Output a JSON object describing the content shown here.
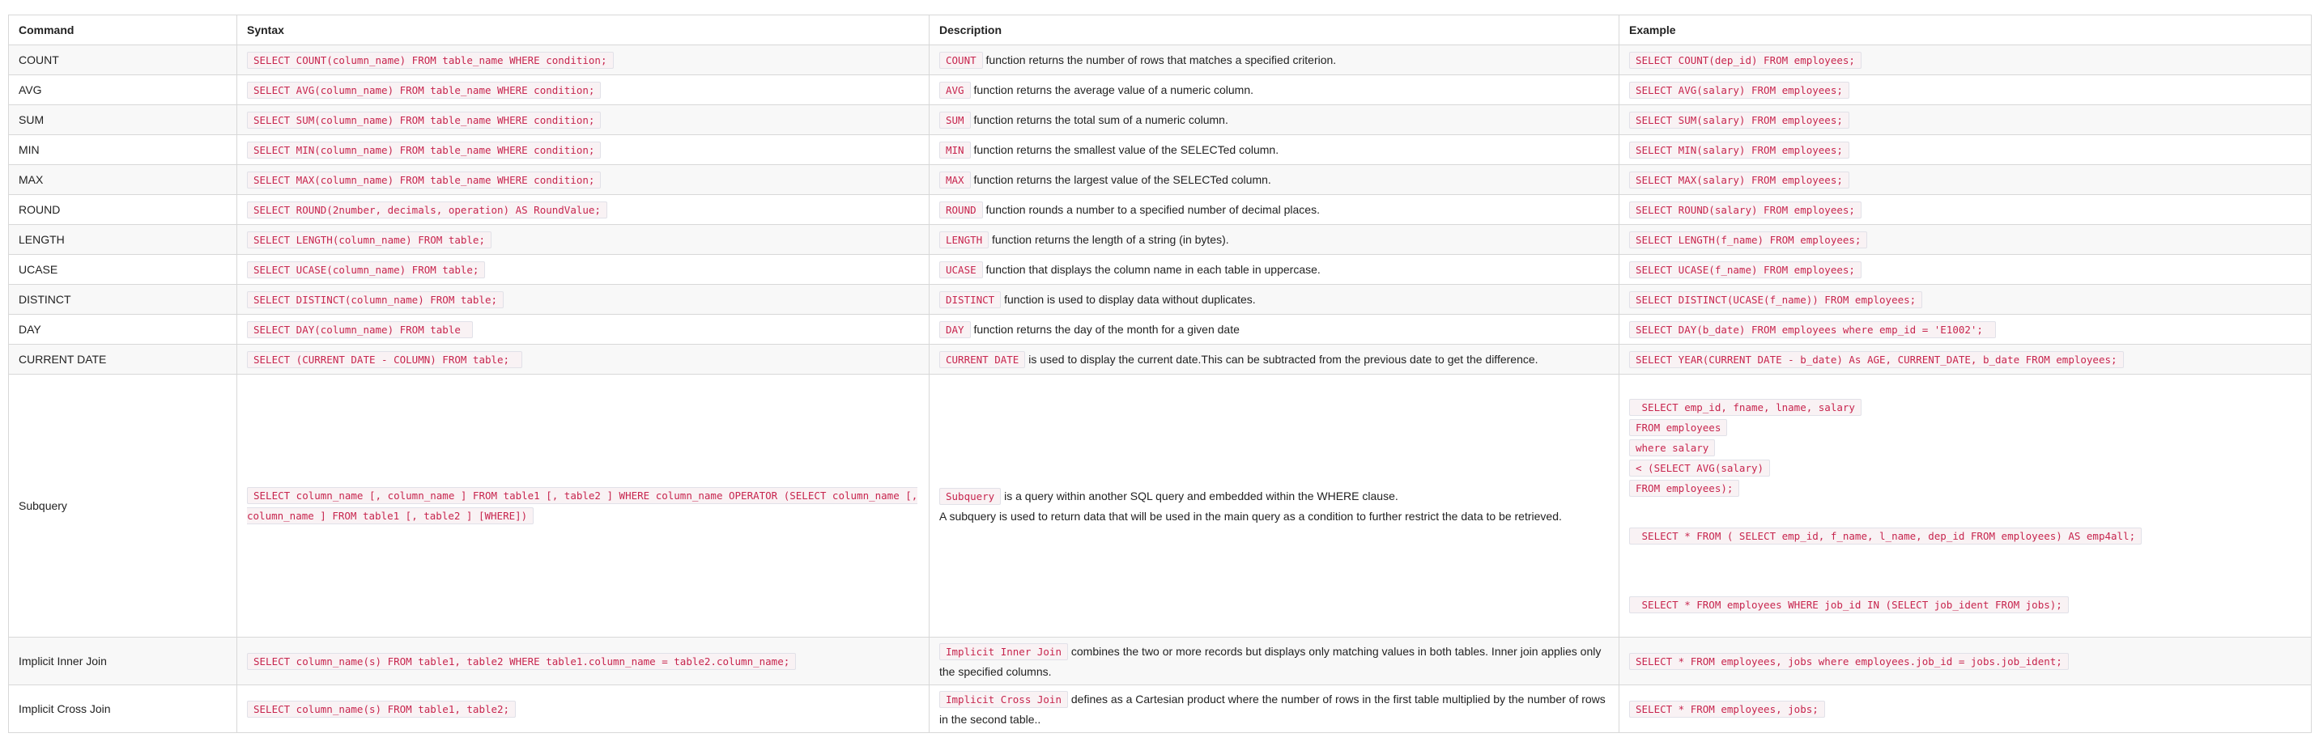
{
  "headers": {
    "command": "Command",
    "syntax": "Syntax",
    "description": "Description",
    "example": "Example"
  },
  "rows": [
    {
      "command": "COUNT",
      "syntax": "SELECT COUNT(column_name) FROM table_name WHERE condition;",
      "desc_code": "COUNT",
      "desc_text": "function returns the number of rows that matches a specified criterion.",
      "example": "SELECT COUNT(dep_id) FROM employees;"
    },
    {
      "command": "AVG",
      "syntax": "SELECT AVG(column_name) FROM table_name WHERE condition;",
      "desc_code": "AVG",
      "desc_text": "function returns the average value of a numeric column.",
      "example": "SELECT AVG(salary) FROM employees;"
    },
    {
      "command": "SUM",
      "syntax": "SELECT SUM(column_name) FROM table_name WHERE condition;",
      "desc_code": "SUM",
      "desc_text": "function returns the total sum of a numeric column.",
      "example": "SELECT SUM(salary) FROM employees;"
    },
    {
      "command": "MIN",
      "syntax": "SELECT MIN(column_name) FROM table_name WHERE condition;",
      "desc_code": "MIN",
      "desc_text": "function returns the smallest value of the SELECTed column.",
      "example": "SELECT MIN(salary) FROM employees;"
    },
    {
      "command": "MAX",
      "syntax": "SELECT MAX(column_name) FROM table_name WHERE condition;",
      "desc_code": "MAX",
      "desc_text": "function returns the largest value of the SELECTed column.",
      "example": "SELECT MAX(salary) FROM employees;"
    },
    {
      "command": "ROUND",
      "syntax": "SELECT ROUND(2number, decimals, operation) AS RoundValue;",
      "desc_code": "ROUND",
      "desc_text": "function rounds a number to a specified number of decimal places.",
      "example": "SELECT ROUND(salary) FROM employees;"
    },
    {
      "command": "LENGTH",
      "syntax": "SELECT LENGTH(column_name) FROM table;",
      "desc_code": "LENGTH",
      "desc_text": "function returns the length of a string (in bytes).",
      "example": "SELECT LENGTH(f_name) FROM employees;"
    },
    {
      "command": "UCASE",
      "syntax": "SELECT UCASE(column_name) FROM table;",
      "desc_code": "UCASE",
      "desc_text": "function that displays the column name in each table in uppercase.",
      "example": "SELECT UCASE(f_name) FROM employees;"
    },
    {
      "command": "DISTINCT",
      "syntax": "SELECT DISTINCT(column_name) FROM table;",
      "desc_code": "DISTINCT",
      "desc_text": "function is used to display data without duplicates.",
      "example": "SELECT DISTINCT(UCASE(f_name)) FROM employees;"
    },
    {
      "command": "DAY",
      "syntax": "SELECT DAY(column_name) FROM table ",
      "desc_code": "DAY",
      "desc_text": "function returns the day of the month for a given date",
      "example": "SELECT DAY(b_date) FROM employees where emp_id = 'E1002'; "
    },
    {
      "command": "CURRENT DATE",
      "syntax": "SELECT (CURRENT DATE - COLUMN) FROM table; ",
      "desc_code": "CURRENT DATE",
      "desc_text": "is used to display the current date.This can be subtracted from the previous date to get the difference.",
      "example": "SELECT YEAR(CURRENT DATE - b_date) As AGE, CURRENT_DATE, b_date FROM employees;"
    }
  ],
  "subquery": {
    "command": "Subquery",
    "syntax": "SELECT column_name [, column_name ] FROM table1 [, table2 ] WHERE column_name OPERATOR (SELECT column_name [, column_name ] FROM table1 [, table2 ] [WHERE]) ",
    "desc_code": "Subquery",
    "desc_text": "is a query within another SQL query and embedded within the WHERE clause.",
    "desc_text2": "A subquery is used to return data that will be used in the main query as a condition to further restrict the data to be retrieved.",
    "example1_lines": [
      " SELECT emp_id, fname, lname, salary",
      "FROM employees",
      "where salary",
      "< (SELECT AVG(salary)",
      "FROM employees);"
    ],
    "example2": " SELECT * FROM ( SELECT emp_id, f_name, l_name, dep_id FROM employees) AS emp4all;",
    "example3": " SELECT * FROM employees WHERE job_id IN (SELECT job_ident FROM jobs);"
  },
  "joins": [
    {
      "command": "Implicit Inner Join",
      "syntax": "SELECT column_name(s) FROM table1, table2 WHERE table1.column_name = table2.column_name;",
      "desc_code": "Implicit Inner Join",
      "desc_text": "combines the two or more records but displays only matching values in both tables. Inner join applies only the specified columns.",
      "example": "SELECT * FROM employees, jobs where employees.job_id = jobs.job_ident;"
    },
    {
      "command": "Implicit Cross Join",
      "syntax": "SELECT column_name(s) FROM table1, table2;",
      "desc_code": "Implicit Cross Join",
      "desc_text": "defines as a Cartesian product where the number of rows in the first table multiplied by the number of rows in the second table..",
      "example": "SELECT * FROM employees, jobs;"
    }
  ]
}
